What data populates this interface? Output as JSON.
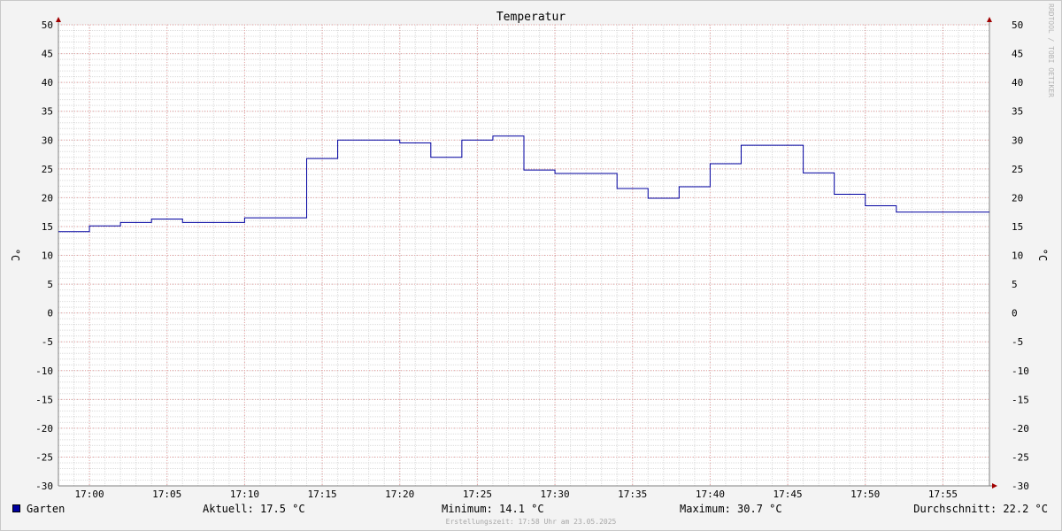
{
  "chart_data": {
    "type": "line",
    "title": "Temperatur",
    "ylabel_left": "°C",
    "ylabel_right": "°C",
    "ylim": [
      -30,
      50
    ],
    "ytick_step": 5,
    "xticks": [
      "17:00",
      "17:05",
      "17:10",
      "17:15",
      "17:20",
      "17:25",
      "17:30",
      "17:35",
      "17:40",
      "17:45",
      "17:50",
      "17:55"
    ],
    "x_range_minutes": [
      "16:58",
      "17:58"
    ],
    "grid": true,
    "series": [
      {
        "name": "Garten",
        "color": "#0000a0",
        "step": true,
        "x": [
          "16:58",
          "17:00",
          "17:02",
          "17:04",
          "17:06",
          "17:10",
          "17:14",
          "17:16",
          "17:20",
          "17:22",
          "17:24",
          "17:26",
          "17:28",
          "17:30",
          "17:34",
          "17:36",
          "17:38",
          "17:40",
          "17:42",
          "17:46",
          "17:48",
          "17:50",
          "17:52",
          "17:58"
        ],
        "values": [
          14.1,
          15.1,
          15.7,
          16.3,
          15.7,
          16.5,
          26.8,
          30.0,
          29.5,
          27.0,
          30.0,
          30.7,
          24.8,
          24.2,
          21.6,
          19.9,
          21.9,
          25.9,
          29.1,
          24.3,
          20.6,
          18.6,
          17.5,
          17.5
        ]
      }
    ]
  },
  "legend": {
    "series_name": "Garten",
    "aktuell": "Aktuell: 17.5 °C",
    "minimum": "Minimum: 14.1 °C",
    "maximum": "Maximum: 30.7 °C",
    "durchschnitt": "Durchschnitt: 22.2 °C"
  },
  "creation_time": "Erstellungszeit: 17:58 Uhr am 23.05.2025",
  "watermark": "RRDTOOL / TOBI OETIKER"
}
